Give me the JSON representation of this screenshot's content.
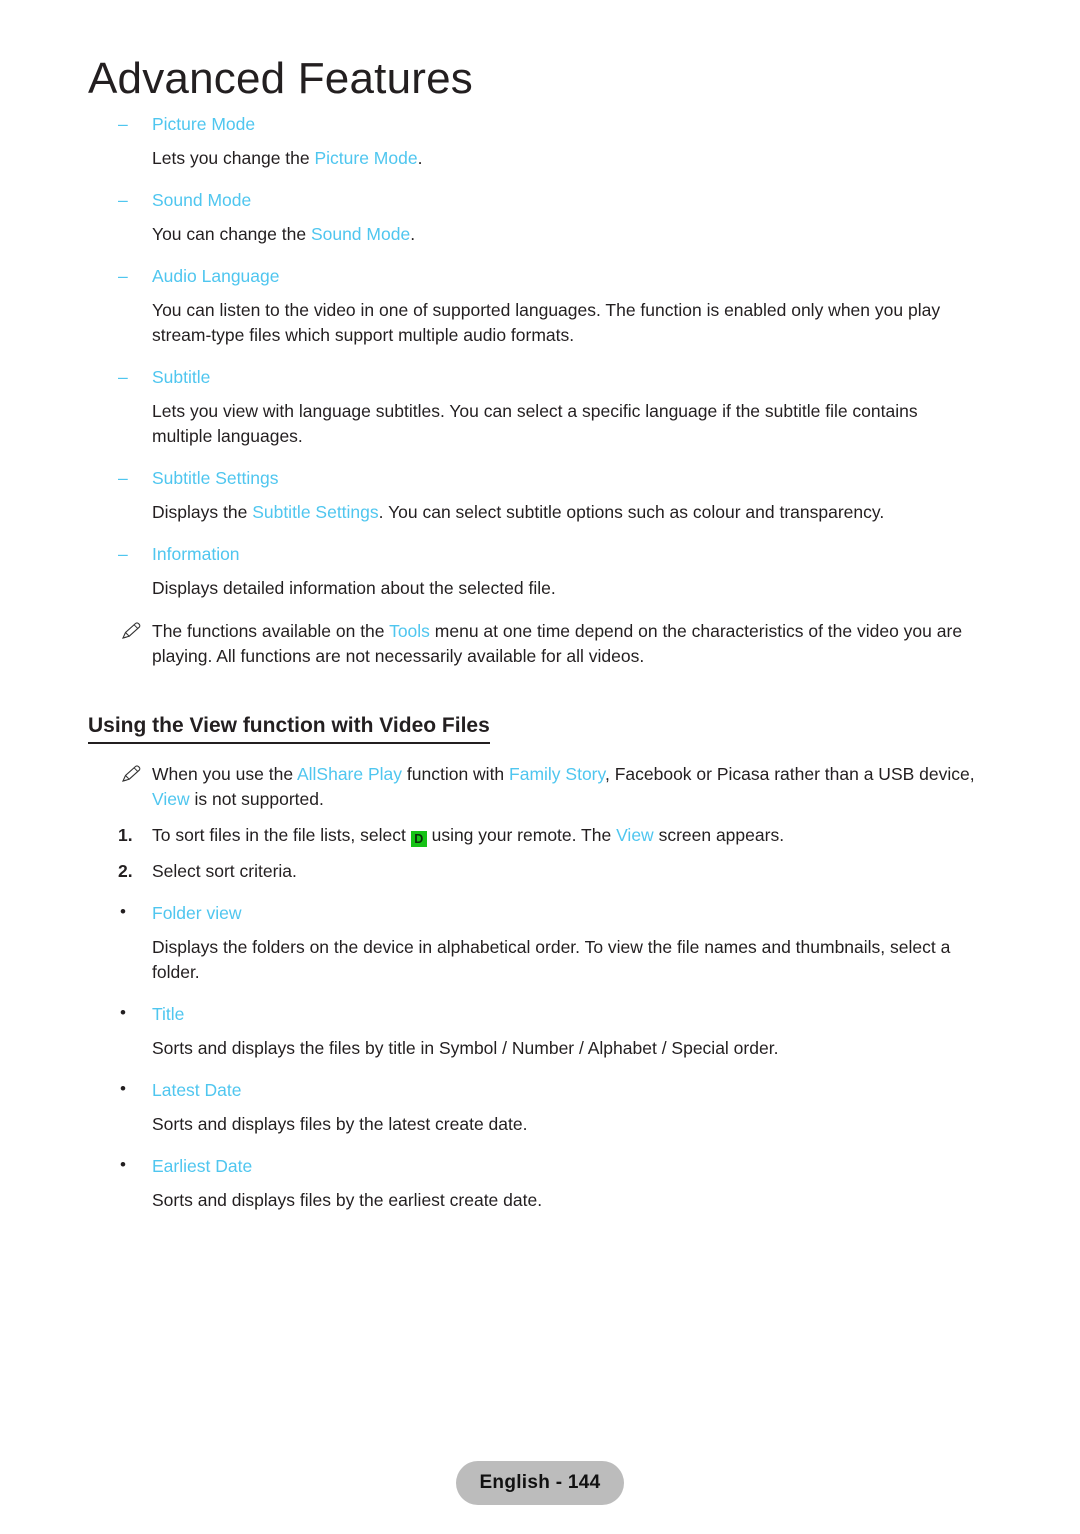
{
  "page": {
    "chapter_title": "Advanced Features",
    "footer_label": "English - 144",
    "accent_color": "#4fc6ef",
    "text_color": "#231f20",
    "key_color": "#16c216",
    "footer_pill_color": "#bcbcbc"
  },
  "dash_bullet": "–",
  "round_bullet": "•",
  "items": {
    "picture_mode": {
      "label": "Picture Mode",
      "desc_pre": "Lets you change the ",
      "desc_link": "Picture Mode",
      "desc_post": "."
    },
    "sound_mode": {
      "label": "Sound Mode",
      "desc_pre": "You can change the ",
      "desc_link": "Sound Mode",
      "desc_post": "."
    },
    "audio_language": {
      "label": "Audio Language",
      "desc": "You can listen to the video in one of supported languages. The function is enabled only when you play stream-type files which support multiple audio formats."
    },
    "subtitle": {
      "label": "Subtitle",
      "desc": "Lets you view with language subtitles. You can select a specific language if the subtitle file contains multiple languages."
    },
    "subtitle_settings": {
      "label": "Subtitle Settings",
      "desc_pre": "Displays the ",
      "desc_link": "Subtitle Settings",
      "desc_post": ". You can select subtitle options such as colour and transparency."
    },
    "information": {
      "label": "Information",
      "desc": "Displays detailed information about the selected file."
    }
  },
  "note_tools": {
    "pre": "The functions available on the ",
    "link": "Tools",
    "post": " menu at one time depend on the characteristics of the video you are playing. All functions are not necessarily available for all videos."
  },
  "section": {
    "heading": "Using the View function with Video Files",
    "note": {
      "pre": "When you use the ",
      "link1": "AllShare Play",
      "mid1": " function with ",
      "link2": "Family Story",
      "mid2": ", Facebook or Picasa rather than a USB device, ",
      "link3": "View",
      "post": " is not supported."
    },
    "steps": [
      {
        "num": "1.",
        "pre": "To sort files in the file lists, select ",
        "key": "D",
        "mid": " using your remote. The ",
        "link": "View",
        "post": " screen appears."
      },
      {
        "num": "2.",
        "pre": "Select sort criteria.",
        "key": "",
        "mid": "",
        "link": "",
        "post": ""
      }
    ],
    "criteria": [
      {
        "label": "Folder view",
        "desc": "Displays the folders on the device in alphabetical order. To view the file names and thumbnails, select a folder."
      },
      {
        "label": "Title",
        "desc": "Sorts and displays the files by title in Symbol / Number / Alphabet / Special order."
      },
      {
        "label": "Latest Date",
        "desc": "Sorts and displays files by the latest create date."
      },
      {
        "label": "Earliest Date",
        "desc": "Sorts and displays files by the earliest create date."
      }
    ]
  },
  "icons": {
    "note": "pencil-note-icon"
  }
}
